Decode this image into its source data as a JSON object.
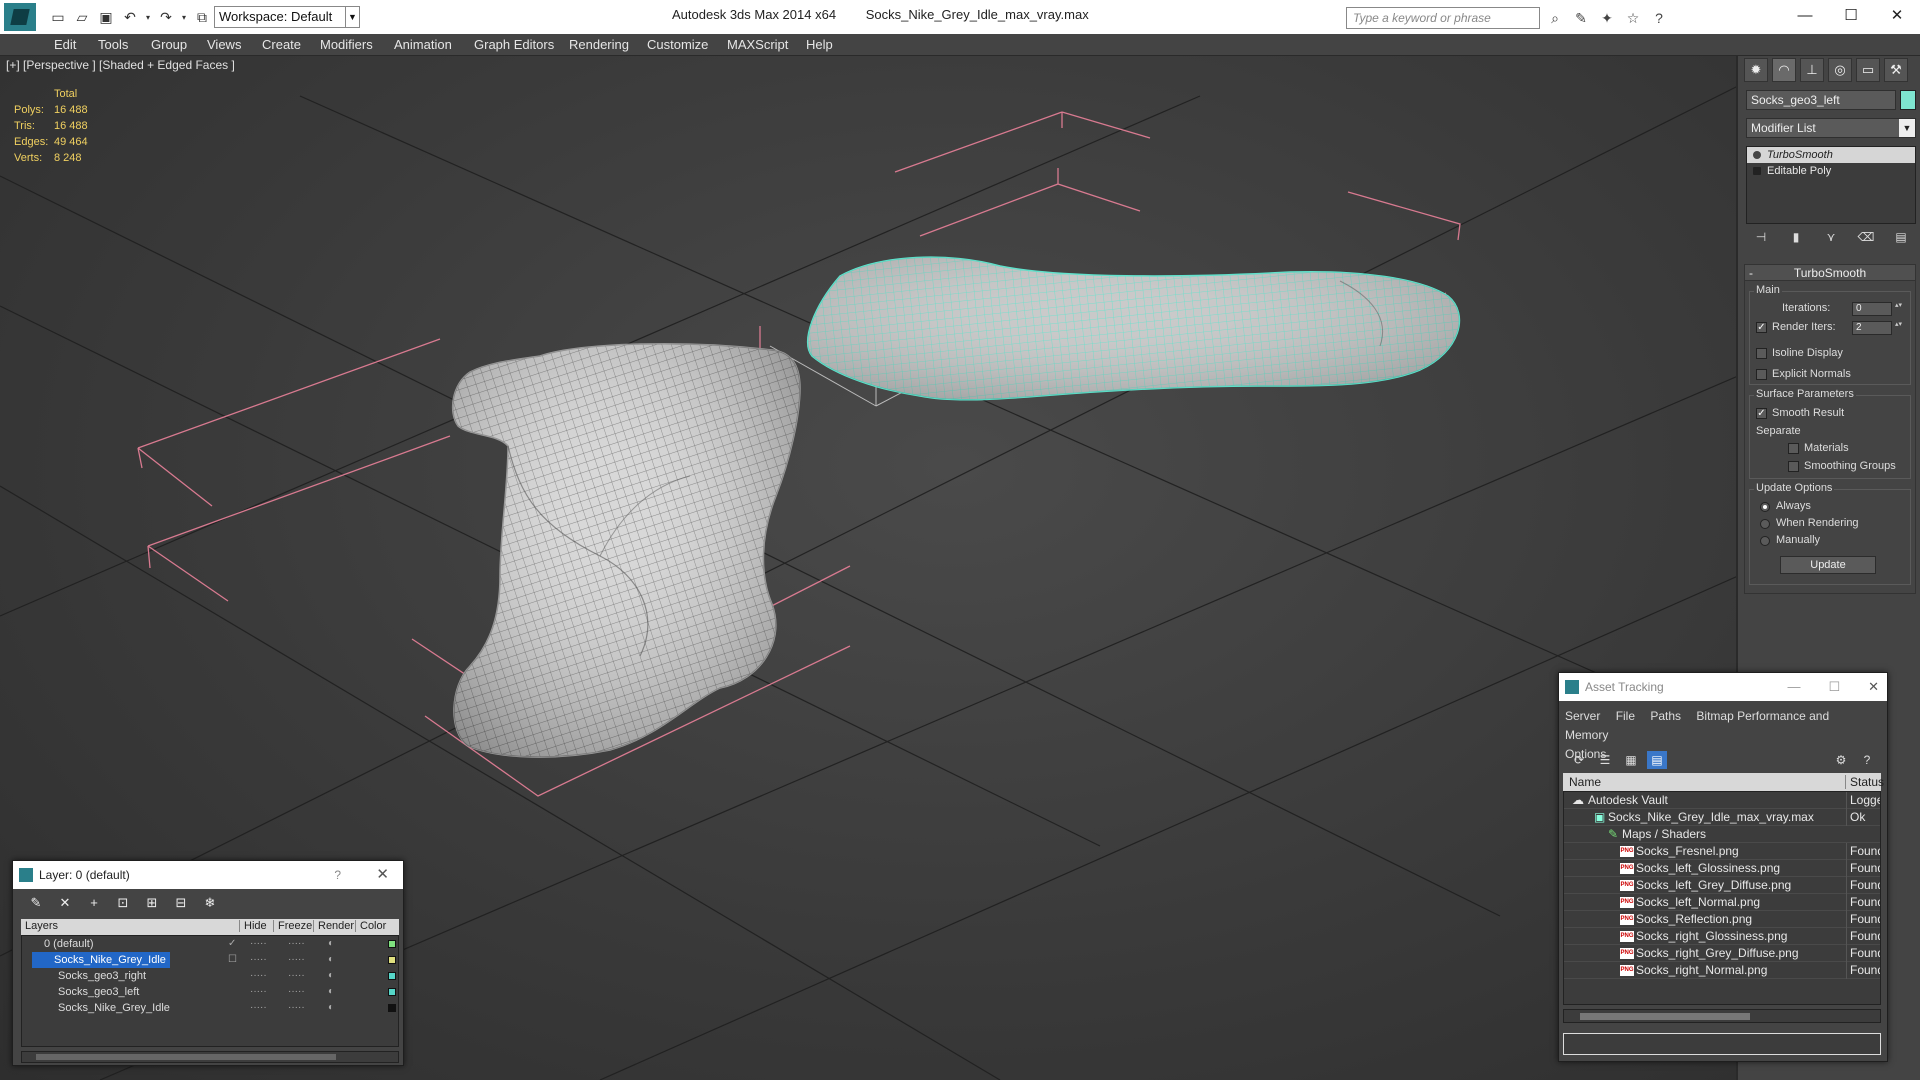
{
  "app": {
    "title": "Autodesk 3ds Max  2014 x64",
    "file": "Socks_Nike_Grey_Idle_max_vray.max",
    "workspace": "Workspace: Default",
    "search_placeholder": "Type a keyword or phrase"
  },
  "menu": [
    "Edit",
    "Tools",
    "Group",
    "Views",
    "Create",
    "Modifiers",
    "Animation",
    "Graph Editors",
    "Rendering",
    "Customize",
    "MAXScript",
    "Help"
  ],
  "viewport": {
    "label": "[+] [Perspective ] [Shaded + Edged Faces ]",
    "stats": {
      "header": "Total",
      "rows": [
        {
          "k": "Polys:",
          "v": "16 488"
        },
        {
          "k": "Tris:",
          "v": "16 488"
        },
        {
          "k": "Edges:",
          "v": "49 464"
        },
        {
          "k": "Verts:",
          "v": "8 248"
        }
      ]
    }
  },
  "command_panel": {
    "object_name": "Socks_geo3_left",
    "object_color": "#7fe6d0",
    "modifier_list": "Modifier List",
    "stack": [
      "TurboSmooth",
      "Editable Poly"
    ],
    "rollout": {
      "title": "TurboSmooth",
      "main_label": "Main",
      "iterations_label": "Iterations:",
      "iterations_value": "0",
      "render_iters_label": "Render Iters:",
      "render_iters_value": "2",
      "isoline": "Isoline Display",
      "explicit_normals": "Explicit Normals",
      "surface_label": "Surface Parameters",
      "smooth_result": "Smooth Result",
      "separate": "Separate",
      "materials": "Materials",
      "smoothing_groups": "Smoothing Groups",
      "update_options": "Update Options",
      "always": "Always",
      "when_rendering": "When Rendering",
      "manually": "Manually",
      "update_button": "Update"
    }
  },
  "layer_panel": {
    "title": "Layer: 0 (default)",
    "help": "?",
    "columns": [
      "Layers",
      "Hide",
      "Freeze",
      "Render",
      "Color"
    ],
    "rows": [
      {
        "name": "0 (default)",
        "color": "#7fe07f"
      },
      {
        "name": "Socks_Nike_Grey_Idle",
        "color": "#e0e07f"
      },
      {
        "name": "Socks_geo3_right",
        "color": "#56d6c8"
      },
      {
        "name": "Socks_geo3_left",
        "color": "#56d6c8"
      },
      {
        "name": "Socks_Nike_Grey_Idle",
        "color": "#111111"
      }
    ]
  },
  "asset_tracking": {
    "title": "Asset Tracking",
    "menu": [
      "Server",
      "File",
      "Paths",
      "Bitmap Performance and Memory",
      "Options"
    ],
    "columns": [
      "Name",
      "Status"
    ],
    "rows": [
      {
        "name": "Autodesk Vault",
        "status": "Logged"
      },
      {
        "name": "Socks_Nike_Grey_Idle_max_vray.max",
        "status": "Ok"
      },
      {
        "name": "Maps / Shaders",
        "status": ""
      },
      {
        "name": "Socks_Fresnel.png",
        "status": "Found"
      },
      {
        "name": "Socks_left_Glossiness.png",
        "status": "Found"
      },
      {
        "name": "Socks_left_Grey_Diffuse.png",
        "status": "Found"
      },
      {
        "name": "Socks_left_Normal.png",
        "status": "Found"
      },
      {
        "name": "Socks_Reflection.png",
        "status": "Found"
      },
      {
        "name": "Socks_right_Glossiness.png",
        "status": "Found"
      },
      {
        "name": "Socks_right_Grey_Diffuse.png",
        "status": "Found"
      },
      {
        "name": "Socks_right_Normal.png",
        "status": "Found"
      }
    ]
  }
}
